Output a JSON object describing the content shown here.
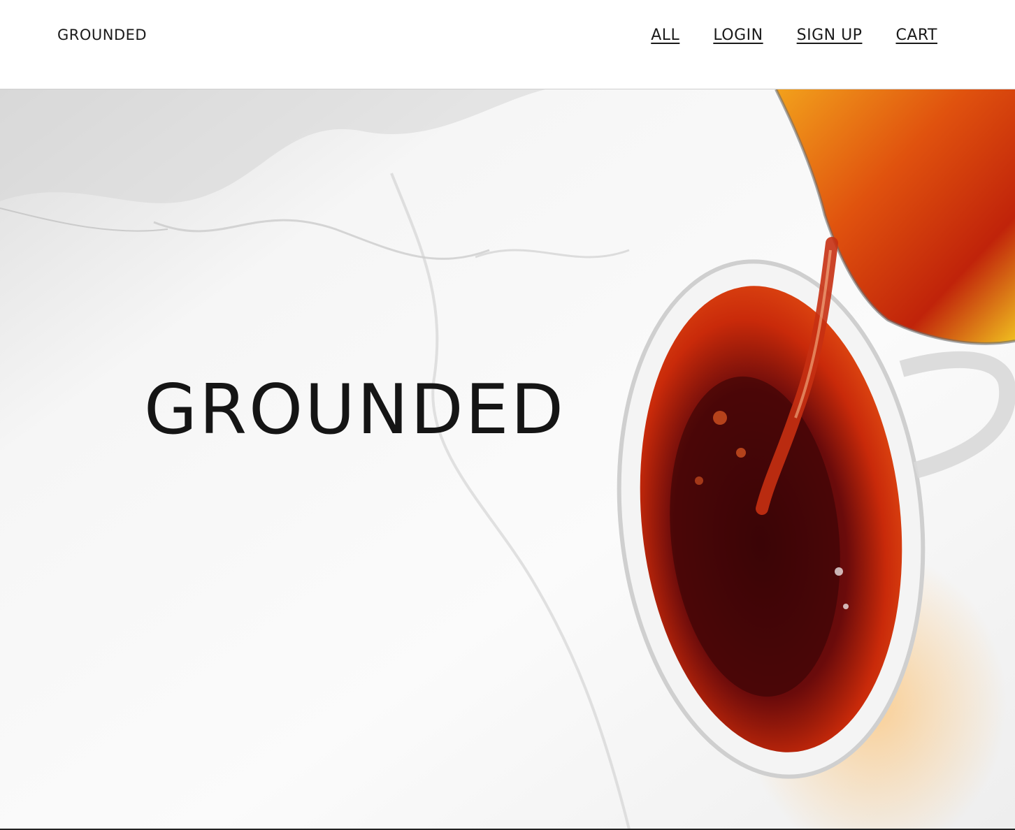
{
  "header": {
    "brand": "GROUNDED",
    "nav": [
      {
        "label": "ALL"
      },
      {
        "label": "LOGIN"
      },
      {
        "label": "SIGN UP"
      },
      {
        "label": "CART"
      }
    ]
  },
  "hero": {
    "title": "GROUNDED",
    "image_description_icon": "tea-pour-hero-image"
  },
  "colors": {
    "text": "#1a1a1a",
    "tea_dark": "#5a0a0a",
    "tea_orange": "#d13a0c",
    "marble": "#f2f2f2"
  }
}
